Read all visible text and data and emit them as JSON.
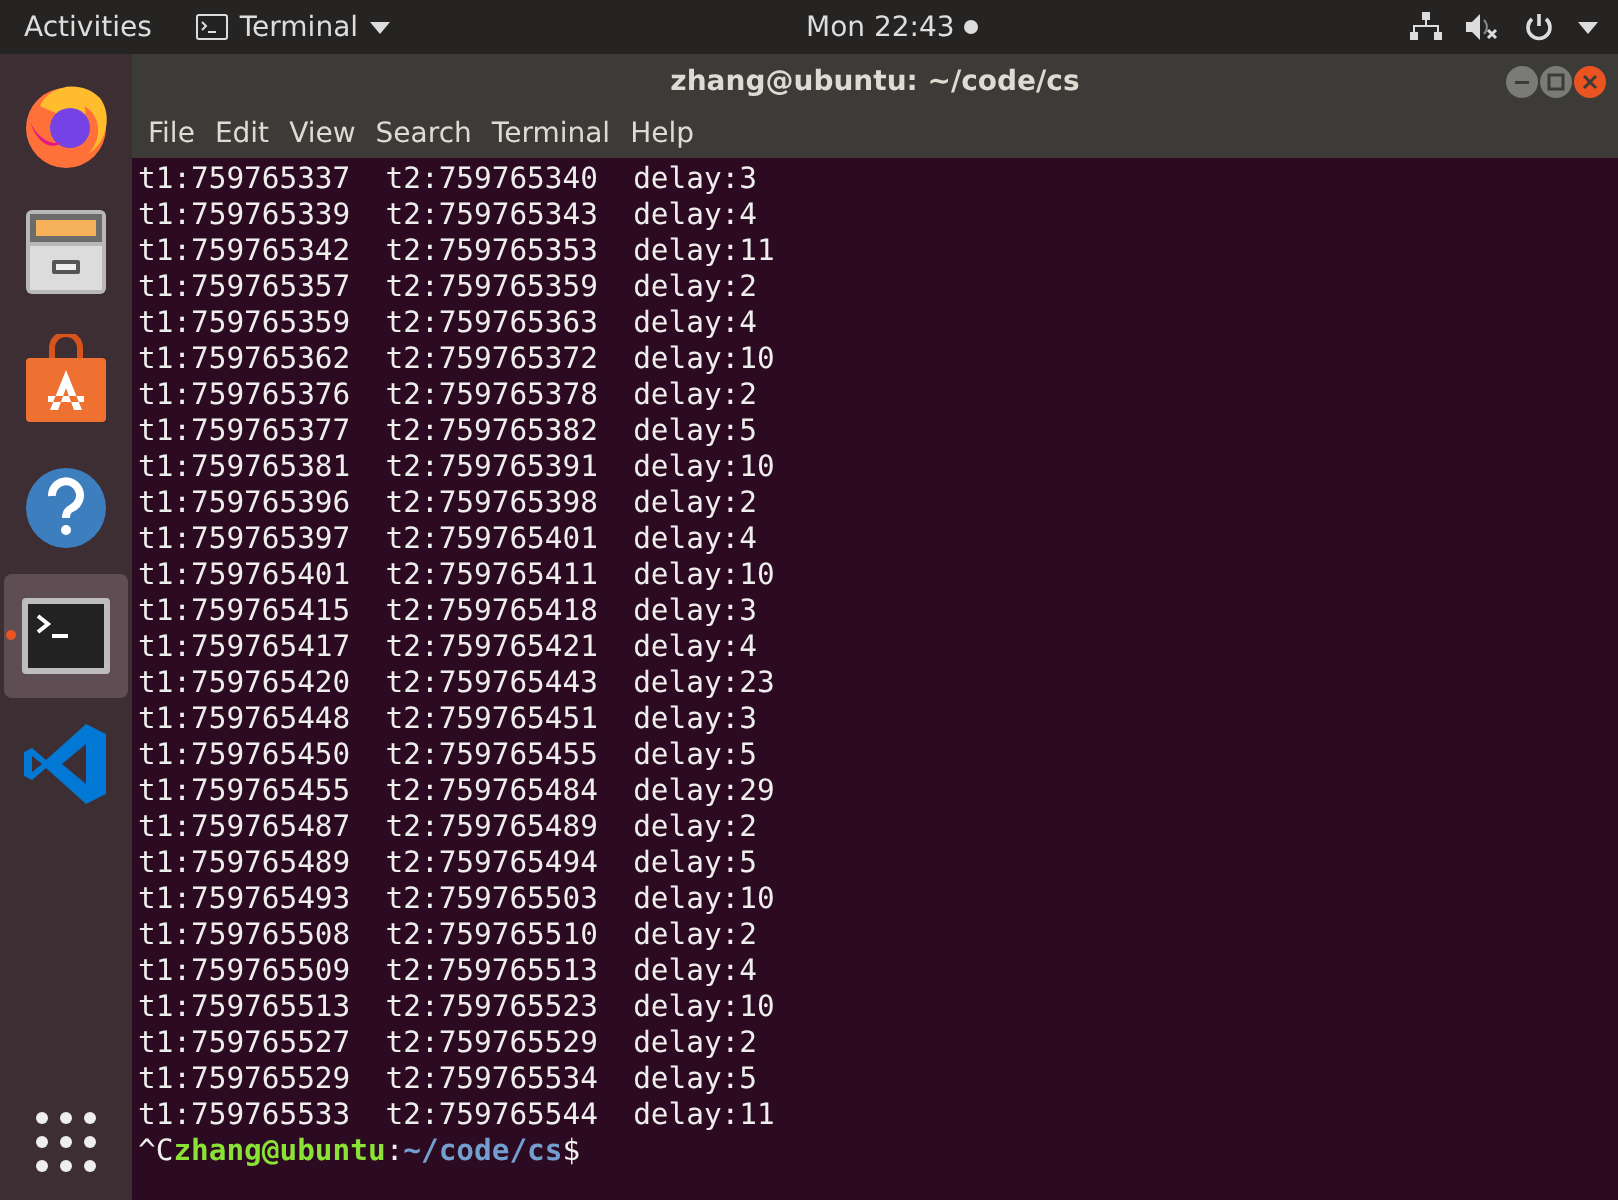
{
  "top_bar": {
    "activities": "Activities",
    "app_menu": "Terminal",
    "clock": "Mon 22:43"
  },
  "dock": {
    "items": [
      {
        "kind": "firefox",
        "selected": false,
        "running": false
      },
      {
        "kind": "files",
        "selected": false,
        "running": false
      },
      {
        "kind": "store",
        "selected": false,
        "running": false
      },
      {
        "kind": "help",
        "selected": false,
        "running": false
      },
      {
        "kind": "terminal",
        "selected": true,
        "running": true
      },
      {
        "kind": "editor",
        "selected": false,
        "running": false
      }
    ]
  },
  "window": {
    "title": "zhang@ubuntu: ~/code/cs",
    "menu": [
      "File",
      "Edit",
      "View",
      "Search",
      "Terminal",
      "Help"
    ]
  },
  "terminal": {
    "lines": [
      "t1:759765337  t2:759765340  delay:3",
      "t1:759765339  t2:759765343  delay:4",
      "t1:759765342  t2:759765353  delay:11",
      "t1:759765357  t2:759765359  delay:2",
      "t1:759765359  t2:759765363  delay:4",
      "t1:759765362  t2:759765372  delay:10",
      "t1:759765376  t2:759765378  delay:2",
      "t1:759765377  t2:759765382  delay:5",
      "t1:759765381  t2:759765391  delay:10",
      "t1:759765396  t2:759765398  delay:2",
      "t1:759765397  t2:759765401  delay:4",
      "t1:759765401  t2:759765411  delay:10",
      "t1:759765415  t2:759765418  delay:3",
      "t1:759765417  t2:759765421  delay:4",
      "t1:759765420  t2:759765443  delay:23",
      "t1:759765448  t2:759765451  delay:3",
      "t1:759765450  t2:759765455  delay:5",
      "t1:759765455  t2:759765484  delay:29",
      "t1:759765487  t2:759765489  delay:2",
      "t1:759765489  t2:759765494  delay:5",
      "t1:759765493  t2:759765503  delay:10",
      "t1:759765508  t2:759765510  delay:2",
      "t1:759765509  t2:759765513  delay:4",
      "t1:759765513  t2:759765523  delay:10",
      "t1:759765527  t2:759765529  delay:2",
      "t1:759765529  t2:759765534  delay:5",
      "t1:759765533  t2:759765544  delay:11"
    ],
    "prompt": {
      "interrupt": "^C",
      "user_host": "zhang@ubuntu",
      "separator": ":",
      "path": "~/code/cs",
      "symbol": "$"
    }
  }
}
